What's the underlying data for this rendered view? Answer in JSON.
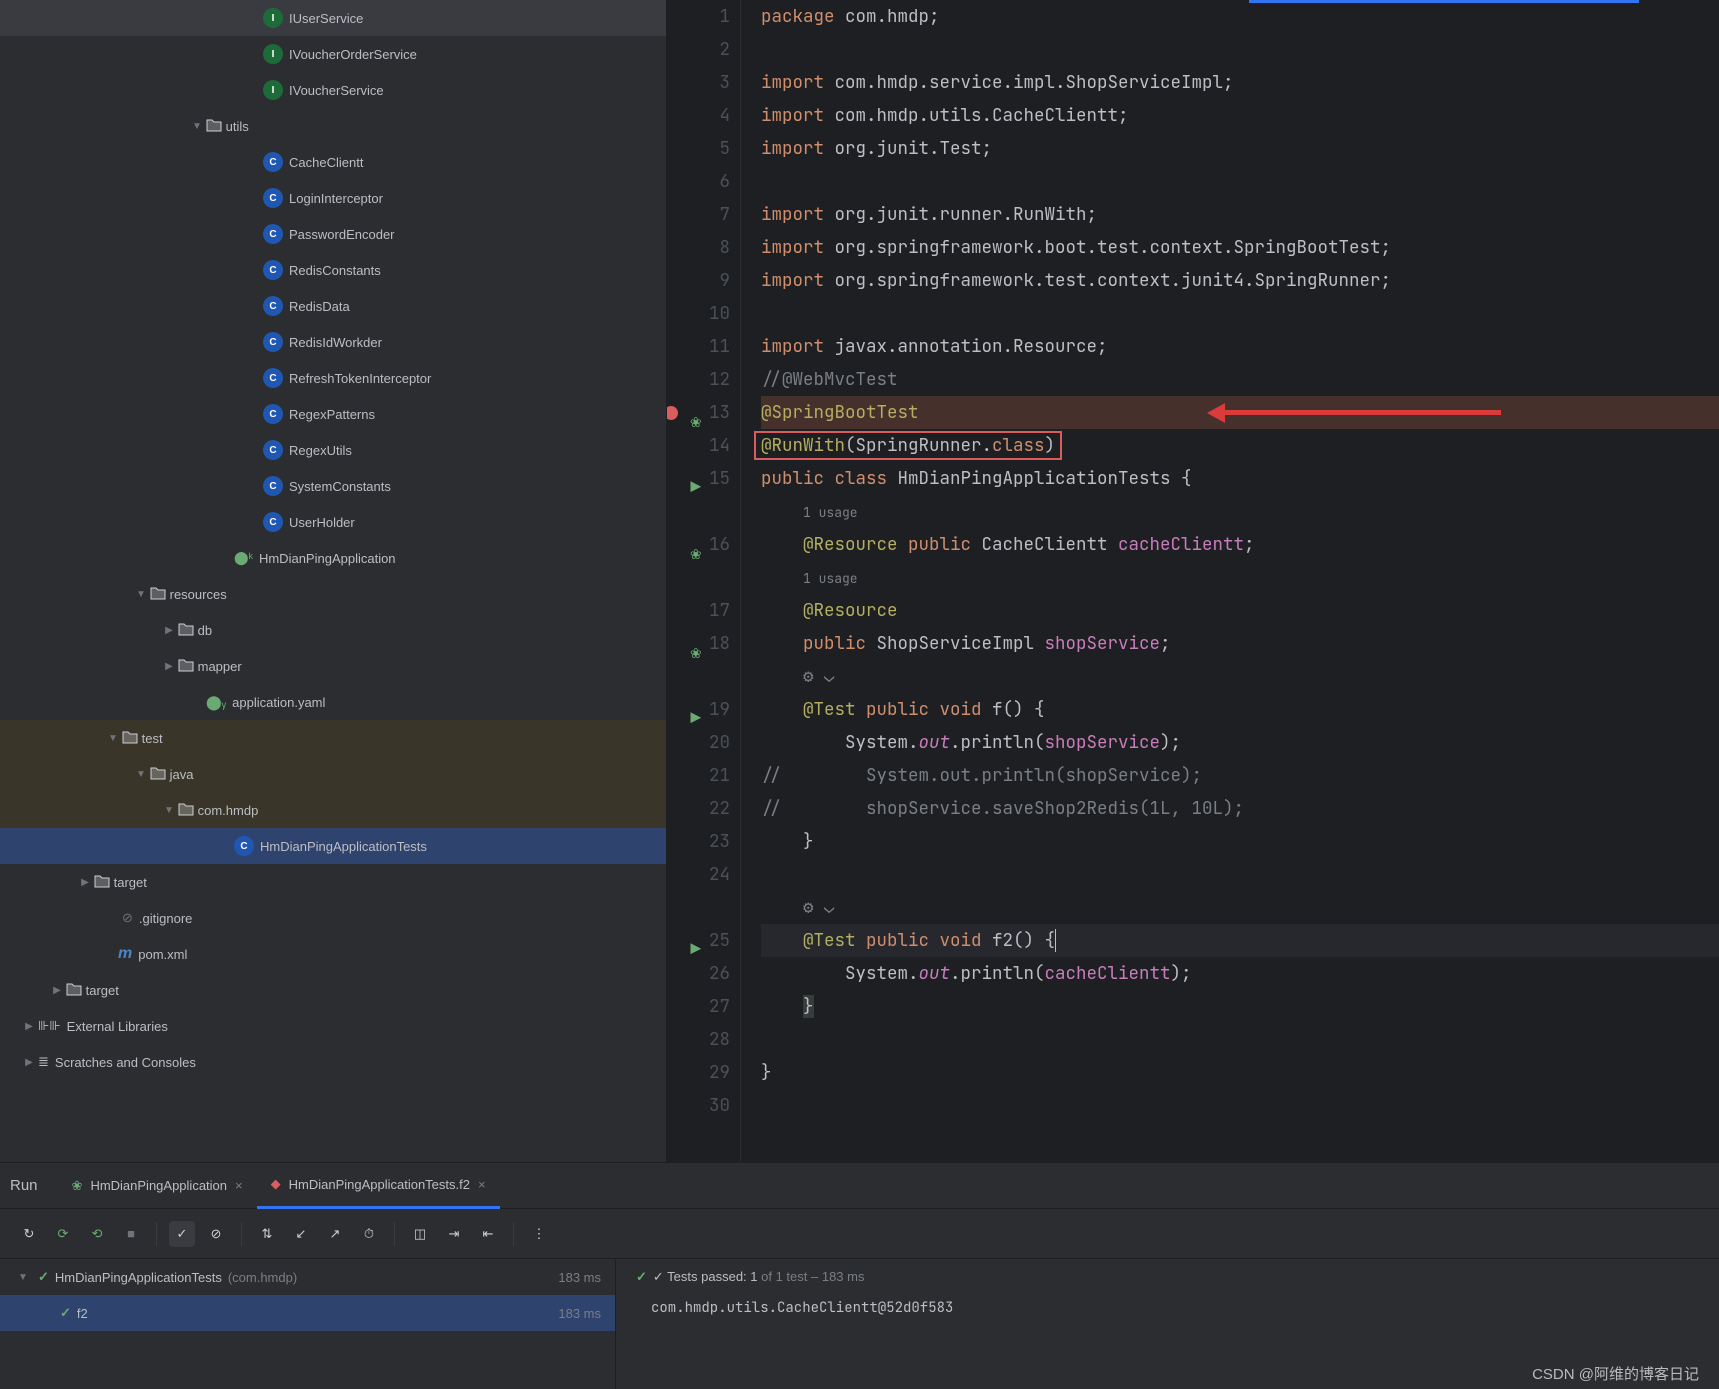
{
  "sidebar": {
    "items": [
      {
        "indent": 245,
        "icon": "I",
        "iconType": "interface",
        "label": "IUserService",
        "chev": ""
      },
      {
        "indent": 245,
        "icon": "I",
        "iconType": "interface",
        "label": "IVoucherOrderService",
        "chev": ""
      },
      {
        "indent": 245,
        "icon": "I",
        "iconType": "interface",
        "label": "IVoucherService",
        "chev": ""
      },
      {
        "indent": 188,
        "icon": "folder",
        "iconType": "folder",
        "label": "utils",
        "chev": "v"
      },
      {
        "indent": 245,
        "icon": "C",
        "iconType": "class",
        "label": "CacheClientt",
        "chev": ""
      },
      {
        "indent": 245,
        "icon": "C",
        "iconType": "class",
        "label": "LoginInterceptor",
        "chev": ""
      },
      {
        "indent": 245,
        "icon": "C",
        "iconType": "class",
        "label": "PasswordEncoder",
        "chev": ""
      },
      {
        "indent": 245,
        "icon": "C",
        "iconType": "class",
        "label": "RedisConstants",
        "chev": ""
      },
      {
        "indent": 245,
        "icon": "C",
        "iconType": "class",
        "label": "RedisData",
        "chev": ""
      },
      {
        "indent": 245,
        "icon": "C",
        "iconType": "class",
        "label": "RedisIdWorkder",
        "chev": ""
      },
      {
        "indent": 245,
        "icon": "C",
        "iconType": "class",
        "label": "RefreshTokenInterceptor",
        "chev": ""
      },
      {
        "indent": 245,
        "icon": "C",
        "iconType": "class",
        "label": "RegexPatterns",
        "chev": ""
      },
      {
        "indent": 245,
        "icon": "C",
        "iconType": "class",
        "label": "RegexUtils",
        "chev": ""
      },
      {
        "indent": 245,
        "icon": "C",
        "iconType": "class",
        "label": "SystemConstants",
        "chev": ""
      },
      {
        "indent": 245,
        "icon": "C",
        "iconType": "class",
        "label": "UserHolder",
        "chev": ""
      },
      {
        "indent": 216,
        "icon": "K",
        "iconType": "kotlin",
        "label": "HmDianPingApplication",
        "chev": ""
      },
      {
        "indent": 132,
        "icon": "folder-res",
        "iconType": "folder",
        "label": "resources",
        "chev": "v"
      },
      {
        "indent": 160,
        "icon": "folder",
        "iconType": "folder",
        "label": "db",
        "chev": ">"
      },
      {
        "indent": 160,
        "icon": "folder",
        "iconType": "folder",
        "label": "mapper",
        "chev": ">"
      },
      {
        "indent": 188,
        "icon": "yaml",
        "iconType": "yaml",
        "label": "application.yaml",
        "chev": ""
      },
      {
        "indent": 104,
        "icon": "folder",
        "iconType": "folder",
        "label": "test",
        "chev": "v",
        "highlight": "test"
      },
      {
        "indent": 132,
        "icon": "folder",
        "iconType": "folder",
        "label": "java",
        "chev": "v",
        "highlight": "test"
      },
      {
        "indent": 160,
        "icon": "folder",
        "iconType": "folder",
        "label": "com.hmdp",
        "chev": "v",
        "highlight": "test"
      },
      {
        "indent": 216,
        "icon": "C",
        "iconType": "class",
        "label": "HmDianPingApplicationTests",
        "chev": "",
        "selected": true
      },
      {
        "indent": 76,
        "icon": "folder-target",
        "iconType": "folder",
        "label": "target",
        "chev": ">"
      },
      {
        "indent": 104,
        "icon": "git",
        "iconType": "git",
        "label": ".gitignore",
        "chev": ""
      },
      {
        "indent": 100,
        "icon": "m",
        "iconType": "maven",
        "label": "pom.xml",
        "chev": ""
      },
      {
        "indent": 48,
        "icon": "folder",
        "iconType": "folder",
        "label": "target",
        "chev": ">"
      },
      {
        "indent": 20,
        "icon": "lib",
        "iconType": "lib",
        "label": "External Libraries",
        "chev": ">"
      },
      {
        "indent": 20,
        "icon": "scratch",
        "iconType": "scratch",
        "label": "Scratches and Consoles",
        "chev": ">"
      }
    ]
  },
  "run": {
    "title": "Run",
    "tabs": [
      {
        "label": "HmDianPingApplication",
        "icon": "spring"
      },
      {
        "label": "HmDianPingApplicationTests.f2",
        "icon": "junit",
        "active": true
      }
    ],
    "status": {
      "prefix": "✓ Tests passed: ",
      "passed": "1",
      "middle": " of 1 test – ",
      "time": "183 ms"
    },
    "test_root": {
      "name": "HmDianPingApplicationTests",
      "pkg": "(com.hmdp)",
      "time": "183 ms"
    },
    "test_child": {
      "name": "f2",
      "time": "183 ms"
    },
    "console": "com.hmdp.utils.CacheClientt@52d0f583"
  },
  "watermark": "CSDN @阿维的博客日记"
}
